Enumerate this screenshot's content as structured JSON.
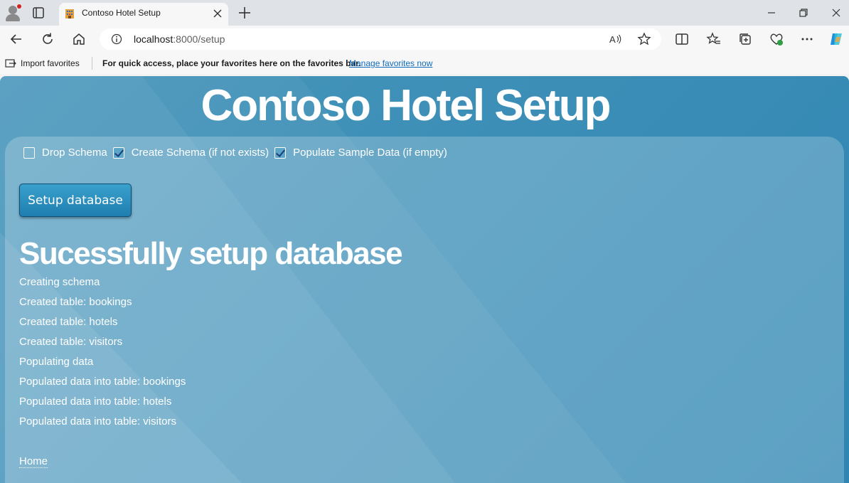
{
  "browser": {
    "tab_title": "Contoso Hotel Setup",
    "url_host": "localhost",
    "url_path": ":8000/setup",
    "favorites": {
      "import_label": "Import favorites",
      "quick_access_text": "For quick access, place your favorites here on the favorites bar.",
      "manage_link": "Manage favorites now"
    },
    "icons": [
      "profile-icon",
      "tab-actions-icon",
      "hotel-favicon",
      "close-tab-icon",
      "new-tab-icon",
      "minimize-icon",
      "restore-icon",
      "close-window-icon",
      "back-icon",
      "refresh-icon",
      "home-icon",
      "info-icon",
      "read-aloud-icon",
      "favorite-star-icon",
      "split-screen-icon",
      "favorites-icon",
      "collections-icon",
      "browser-essentials-icon",
      "more-icon",
      "copilot-icon",
      "import-favorites-icon"
    ]
  },
  "page": {
    "title": "Contoso Hotel Setup",
    "options": [
      {
        "label": "Drop Schema",
        "checked": false
      },
      {
        "label": "Create Schema (if not exists)",
        "checked": true
      },
      {
        "label": "Populate Sample Data (if empty)",
        "checked": true
      }
    ],
    "setup_button": "Setup database",
    "result_title": "Sucessfully setup database",
    "log": [
      "Creating schema",
      "Created table: bookings",
      "Created table: hotels",
      "Created table: visitors",
      "Populating data",
      "Populated data into table: bookings",
      "Populated data into table: hotels",
      "Populated data into table: visitors"
    ],
    "home_link": "Home"
  },
  "colors": {
    "page_background": "#3d8fb7",
    "button_background": "#2590c2",
    "link_blue": "#0f6cbd"
  }
}
